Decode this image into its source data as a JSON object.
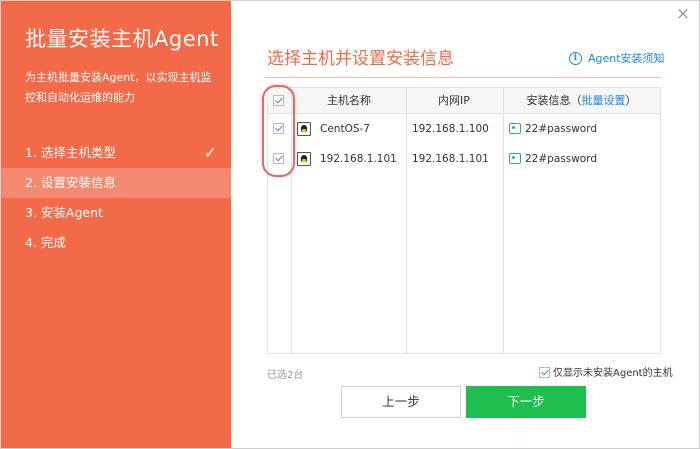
{
  "sidebar": {
    "title": "批量安装主机Agent",
    "description": "为主机批量安装Agent，以实现主机监控和自动化运维的能力",
    "steps": [
      {
        "label": "1. 选择主机类型",
        "done": true
      },
      {
        "label": "2. 设置安装信息",
        "active": true
      },
      {
        "label": "3. 安装Agent"
      },
      {
        "label": "4. 完成"
      }
    ],
    "check_glyph": "✓"
  },
  "window": {
    "close_glyph": "×"
  },
  "main": {
    "title": "选择主机并设置安装信息",
    "help_link": "Agent安装须知",
    "help_icon_glyph": "i"
  },
  "table": {
    "headers": {
      "host_name": "主机名称",
      "ip": "内网IP",
      "install_info": "安装信息（",
      "batch_setting": "批量设置",
      "install_info_close": "）"
    },
    "header_checked": true,
    "rows": [
      {
        "checked": true,
        "host_name": "CentOS-7",
        "ip": "192.168.1.100",
        "install_info": "22#password"
      },
      {
        "checked": true,
        "host_name": "192.168.1.101",
        "ip": "192.168.1.101",
        "install_info": "22#password"
      }
    ]
  },
  "footer": {
    "selected_count": "已选2台",
    "only_uninstalled_label": "仅显示未安装Agent的主机",
    "only_uninstalled_checked": true,
    "prev_button": "上一步",
    "next_button": "下一步"
  },
  "colors": {
    "sidebar_bg": "#f26a48",
    "accent_title": "#f26a48",
    "link": "#1e88e5",
    "next_button": "#1fbf4f",
    "highlight": "#e06a6a"
  }
}
